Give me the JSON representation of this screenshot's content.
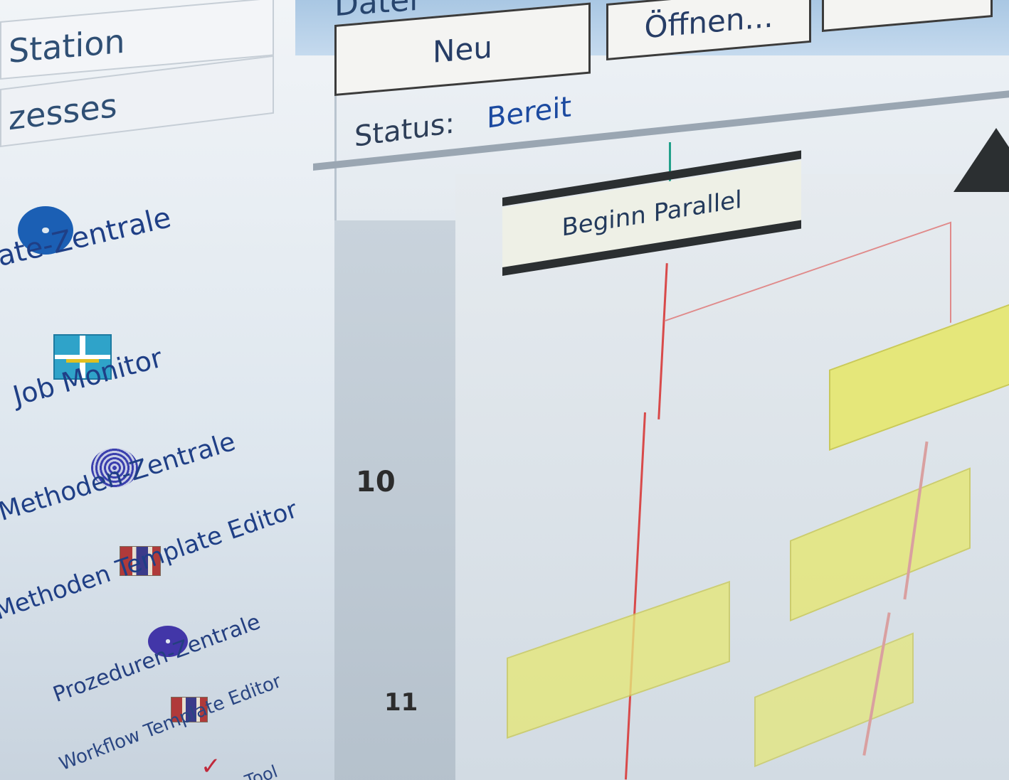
{
  "sidebar": {
    "station_label": "Station",
    "processes_label": "zesses",
    "items": [
      {
        "label": "ate-Zentrale",
        "icon": "blue-disc-icon"
      },
      {
        "label": "Job Monitor",
        "icon": "job-monitor-icon"
      },
      {
        "label": "Methoden-Zentrale",
        "icon": "spiral-icon"
      },
      {
        "label": "Methoden Template Editor",
        "icon": "template-icon"
      },
      {
        "label": "Prozeduren-Zentrale",
        "icon": "purple-disc-icon"
      },
      {
        "label": "Workflow Template Editor",
        "icon": "template-icon"
      },
      {
        "label": "Tool",
        "icon": "tool-icon"
      }
    ]
  },
  "toolbar": {
    "menu_datei": "Datei",
    "new_label": "Neu",
    "open_label": "Öffnen..."
  },
  "status": {
    "label": "Status:",
    "value": "Bereit"
  },
  "workflow": {
    "parallel_label": "Beginn Parallel",
    "row_numbers": [
      "10",
      "11"
    ],
    "colors": {
      "node": "#e5e77a",
      "connector": "#d84a4a",
      "bar": "#2b2f31"
    }
  }
}
